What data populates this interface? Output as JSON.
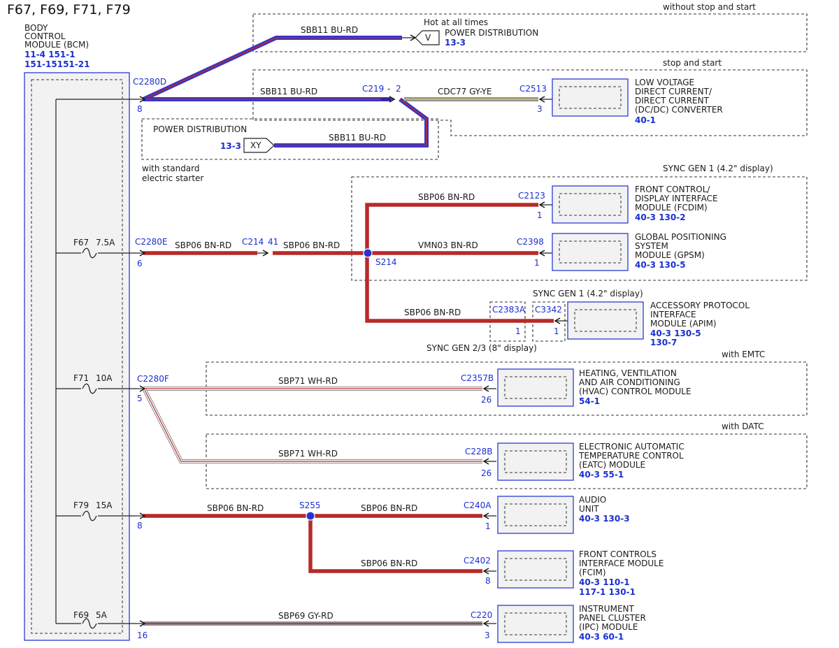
{
  "title": "F67, F69, F71, F79",
  "bcm": {
    "lines": [
      "BODY",
      "CONTROL",
      "MODULE (BCM)"
    ],
    "refs": [
      "11-4  151-1",
      "151-15151-21"
    ]
  },
  "fuses": [
    {
      "id": "F67",
      "rating": "7.5A"
    },
    {
      "id": "F71",
      "rating": "10A"
    },
    {
      "id": "F79",
      "rating": "15A"
    },
    {
      "id": "F69",
      "rating": "5A"
    }
  ],
  "bcm_connectors": [
    {
      "name": "C2280D",
      "pin": "8"
    },
    {
      "name": "C2280E",
      "pin": "6"
    },
    {
      "name": "C2280F",
      "pin": "5"
    },
    {
      "name": "",
      "pin": "8"
    },
    {
      "name": "",
      "pin": "16"
    }
  ],
  "groups": {
    "no_ss": "without stop and start",
    "ss": "stop and start",
    "std_starter": [
      "with standard",
      "electric starter"
    ],
    "sync1": "SYNC GEN 1 (4.2\" display)",
    "sync1b": "SYNC GEN 1 (4.2\" display)",
    "sync23": "SYNC GEN 2/3 (8\" display)",
    "emtc": "with EMTC",
    "datc": "with DATC"
  },
  "power": {
    "hot": "Hot at all times",
    "v_label": "V",
    "v_name": "POWER DISTRIBUTION",
    "v_ref": "13-3",
    "xy_label": "XY",
    "xy_name": "POWER DISTRIBUTION",
    "xy_ref": "13-3"
  },
  "wires": {
    "sbb11": "SBB11  BU-RD",
    "cdc77": "CDC77  GY-YE",
    "sbp06": "SBP06  BN-RD",
    "vmn03": "VMN03  BN-RD",
    "sbp71": "SBP71  WH-RD",
    "sbp69": "SBP69  GY-RD"
  },
  "inline": {
    "c219": "C219",
    "c219_dash": "-",
    "c219_pin": "2",
    "c214": "C214",
    "c214_pin": "41",
    "c2383a": "C2383A",
    "c2383a_pin": "1",
    "c3342": "C3342",
    "c3342_pin": "1"
  },
  "splices": {
    "s214": "S214",
    "s255": "S255"
  },
  "modules": {
    "dcdc": {
      "lines": [
        "LOW VOLTAGE",
        "DIRECT CURRENT/",
        "DIRECT CURRENT",
        "(DC/DC) CONVERTER"
      ],
      "ref": "40-1",
      "conn": "C2513",
      "pin": "3"
    },
    "fcdim": {
      "lines": [
        "FRONT CONTROL/",
        "DISPLAY INTERFACE",
        "MODULE (FCDIM)"
      ],
      "ref": "40-3  130-2",
      "conn": "C2123",
      "pin": "1"
    },
    "gpsm": {
      "lines": [
        "GLOBAL POSITIONING",
        "SYSTEM",
        "MODULE (GPSM)"
      ],
      "ref": "40-3  130-5",
      "conn": "C2398",
      "pin": "1"
    },
    "apim": {
      "lines": [
        "ACCESSORY PROTOCOL",
        "INTERFACE",
        "MODULE (APIM)"
      ],
      "ref": "40-3  130-5",
      "ref2": "130-7"
    },
    "hvac": {
      "lines": [
        "HEATING, VENTILATION",
        "AND AIR CONDITIONING",
        "(HVAC) CONTROL MODULE"
      ],
      "ref": "54-1",
      "conn": "C2357B",
      "pin": "26"
    },
    "eatc": {
      "lines": [
        "ELECTRONIC AUTOMATIC",
        "TEMPERATURE CONTROL",
        "(EATC) MODULE"
      ],
      "ref": "40-3  55-1",
      "conn": "C228B",
      "pin": "26"
    },
    "audio": {
      "lines": [
        "AUDIO",
        "UNIT"
      ],
      "ref": "40-3  130-3",
      "conn": "C240A",
      "pin": "1"
    },
    "fcim": {
      "lines": [
        "FRONT CONTROLS",
        "INTERFACE MODULE",
        "(FCIM)"
      ],
      "ref": "40-3  110-1",
      "ref2": "117-1 130-1",
      "conn": "C2402",
      "pin": "8"
    },
    "ipc": {
      "lines": [
        "INSTRUMENT",
        "PANEL CLUSTER",
        "(IPC) MODULE"
      ],
      "ref": "40-3  60-1",
      "conn": "C220",
      "pin": "3"
    }
  },
  "colors": {
    "blue": "#3434c8",
    "red": "#b82a2a",
    "gray": "#8f8f8f",
    "yellow": "#d8cf3a",
    "white": "#ffffff",
    "connector": "#1a2fd0"
  }
}
